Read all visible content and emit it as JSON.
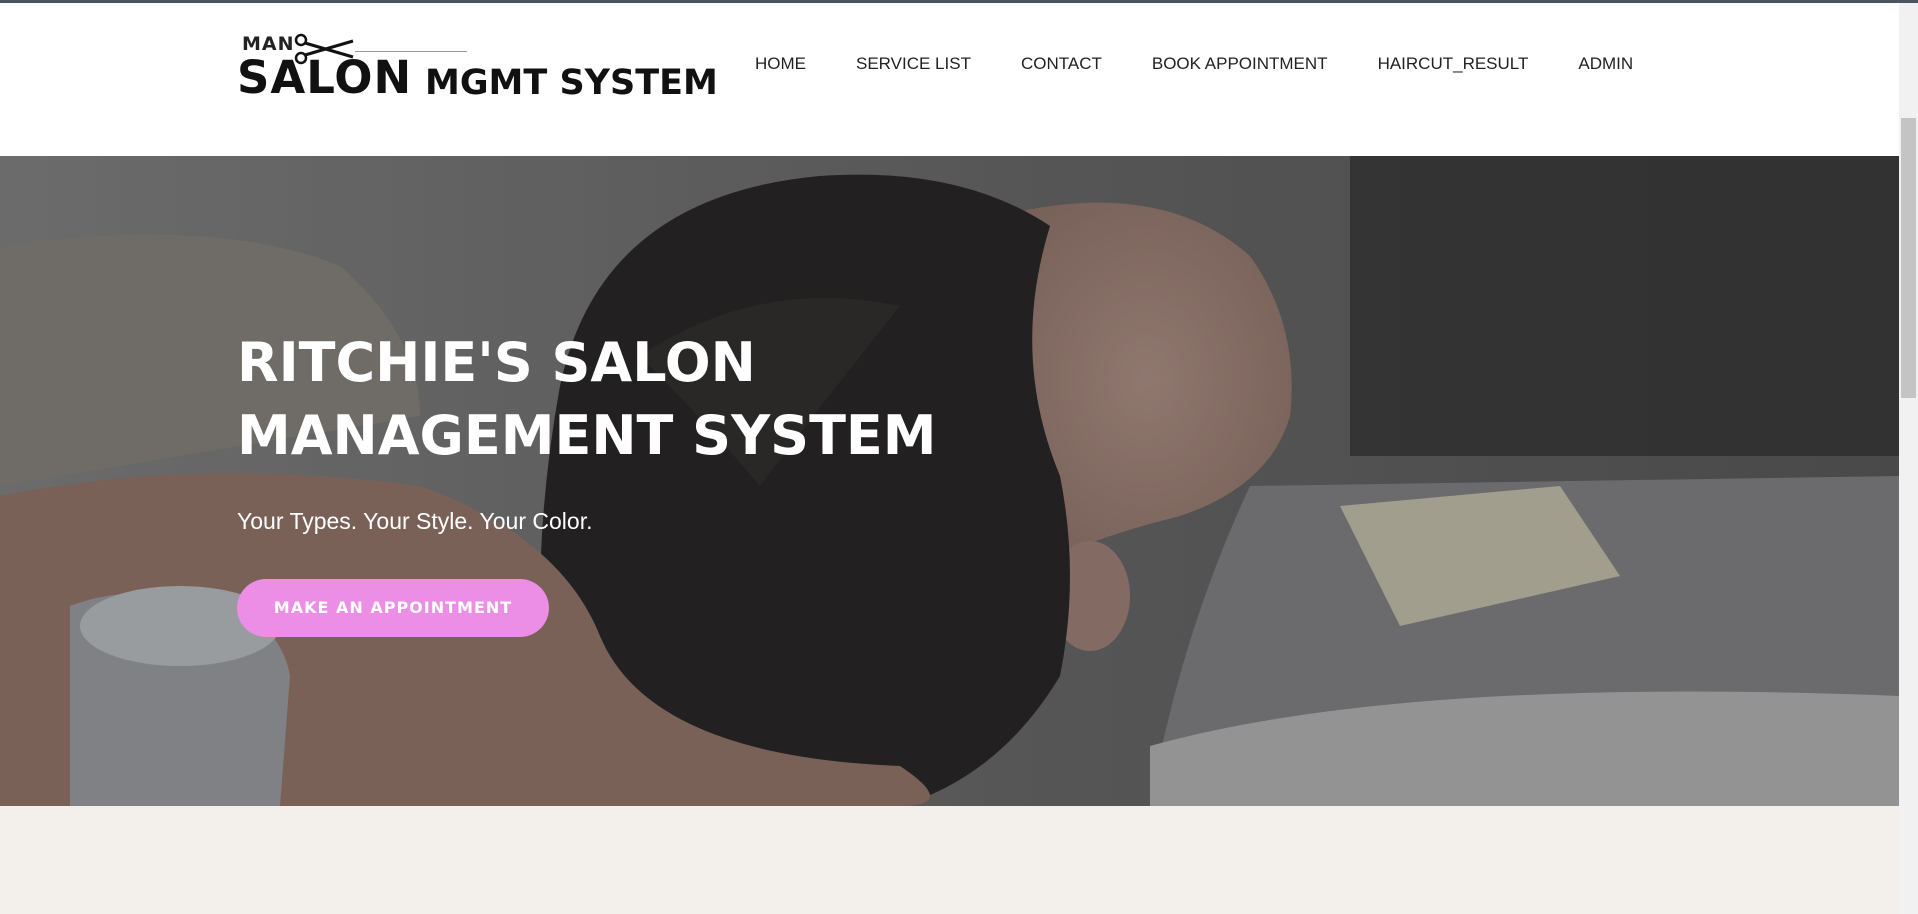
{
  "logo": {
    "line1": "MAN",
    "line2": "SALON",
    "line3": "MGMT SYSTEM",
    "icon": "scissors-icon"
  },
  "nav": {
    "items": [
      {
        "label": "HOME"
      },
      {
        "label": "SERVICE LIST"
      },
      {
        "label": "CONTACT"
      },
      {
        "label": "BOOK APPOINTMENT"
      },
      {
        "label": "HAIRCUT_RESULT"
      },
      {
        "label": "ADMIN"
      }
    ]
  },
  "hero": {
    "title_line1": "RITCHIE'S SALON",
    "title_line2": "MANAGEMENT SYSTEM",
    "subtitle": "Your Types. Your Style. Your Color.",
    "cta_label": "MAKE AN APPOINTMENT"
  },
  "colors": {
    "accent": "#ec8ee6",
    "background": "#f3f0ec",
    "header": "#ffffff"
  }
}
